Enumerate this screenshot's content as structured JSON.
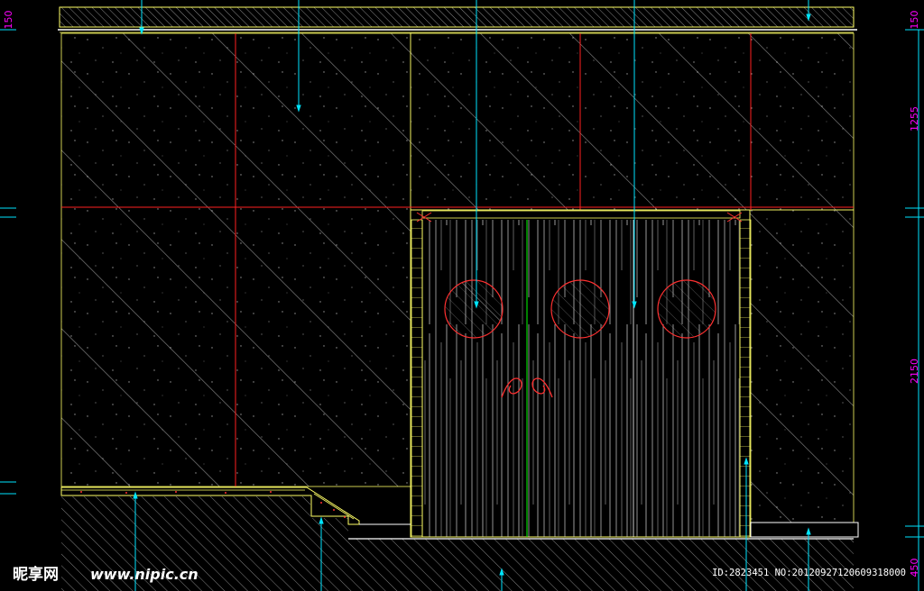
{
  "drawing": {
    "dimensions": [
      {
        "side": "left",
        "label": "150"
      },
      {
        "side": "right",
        "label": "150"
      },
      {
        "side": "right",
        "label": "1255"
      },
      {
        "side": "right",
        "label": "2150"
      },
      {
        "side": "right",
        "label": "450"
      }
    ],
    "colors": {
      "background": "#000000",
      "frame": "#ffff66",
      "grid": "#ff2020",
      "hatch": "#d8d8d8",
      "leader": "#00e5ff",
      "dimension": "#ff00ff",
      "mullion": "#00ff00",
      "porthole": "#ff3030"
    },
    "elements": [
      "ceiling-band",
      "wall-panel-left",
      "wall-panel-right",
      "double-door",
      "porthole-window",
      "door-handle",
      "raised-platform",
      "floor-slab"
    ]
  },
  "watermark": {
    "logo": "昵享网",
    "url": "www.nipic.cn",
    "id_text": "ID:2823451 NO:20120927120609318000"
  }
}
